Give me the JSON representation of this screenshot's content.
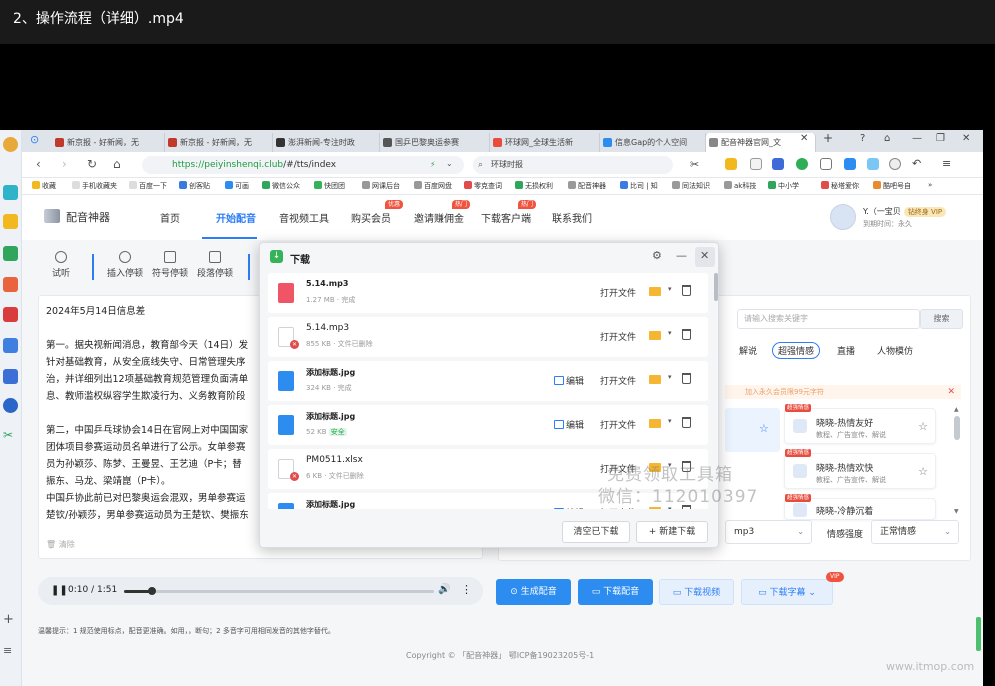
{
  "video_title": "2、操作流程（详细）.mp4",
  "browser": {
    "tabs": [
      {
        "label": "新京报 - 好新闻，无",
        "color": "#c0392b"
      },
      {
        "label": "新京报 - 好新闻，无",
        "color": "#c0392b"
      },
      {
        "label": "澎湃新闻-专注时政",
        "color": "#333333"
      },
      {
        "label": "国乒巴黎奥运参赛",
        "color": "#555555"
      },
      {
        "label": "环球网_全球生活新",
        "color": "#e74c3c"
      },
      {
        "label": "信息Gap的个人空间",
        "color": "#2d8cf0"
      },
      {
        "label": "配音神器官网_文",
        "color": "#888888"
      }
    ],
    "url_prefix": "https://",
    "url_domain": "peiyinshenqi.club",
    "url_path": "/#/tts/index",
    "search_text": "环球时报",
    "bookmarks": [
      "收藏",
      "手机收藏夹",
      "百度一下",
      "创客贴",
      "可画",
      "微信公众",
      "快团团",
      "网课后台",
      "百度网盘",
      "零克查词",
      "无损权利",
      "配音神器",
      "比司 | 知",
      "同法知识",
      "ak科技",
      "中小学",
      "秘塔爱你",
      "酷吧号自"
    ]
  },
  "app": {
    "logo": "配音神器",
    "nav": [
      {
        "label": "首页",
        "tag": ""
      },
      {
        "label": "开始配音",
        "tag": ""
      },
      {
        "label": "音视频工具",
        "tag": ""
      },
      {
        "label": "购买会员",
        "tag": "优惠"
      },
      {
        "label": "邀请赚佣金",
        "tag": "热门"
      },
      {
        "label": "下载客户端",
        "tag": "热门"
      },
      {
        "label": "联系我们",
        "tag": ""
      }
    ],
    "user_name": "Y.（一宝贝",
    "user_vip": "钻终身 VIP",
    "user_expiry": "到期时间：永久"
  },
  "tools": [
    {
      "label": "试听"
    },
    {
      "label": "插入停顿"
    },
    {
      "label": "符号停顿"
    },
    {
      "label": "段落停顿"
    }
  ],
  "editor": {
    "lines": [
      "2024年5月14日信息差",
      "",
      "第一。据央视新闻消息，教育部今天（14日）发",
      "针对基础教育，从安全底线失守、日常管理失序",
      "治，并详细列出12项基础教育规范管理负面清单",
      "息、教师滥权纵容学生欺凌行为、义务教育阶段",
      "",
      "第二，中国乒乓球协会14日在官网上对中国国家",
      "团体项目参赛运动员名单进行了公示。女单参赛",
      "员为孙颖莎、陈梦、王曼昱、王艺迪（P卡；替",
      "振东、马龙、梁靖崑（P卡）。",
      "中国乒协此前已对巴黎奥运会混双，男单参赛运",
      "楚钦/孙颖莎，男单参赛运动员为王楚钦、樊振东"
    ],
    "clear": "清除"
  },
  "player": {
    "time": "0:10 / 1:51",
    "progress": 0.09
  },
  "hint": "温馨提示：1 规范使用标点，配音更准确。如用，，断句；2 多音字可用相同发音的其他字替代。",
  "footer": "Copyright © 「配音神器」 鄂ICP备19023205号-1",
  "site_watermark": "www.itmop.com",
  "download_dialog": {
    "title": "下载",
    "items": [
      {
        "name": "5.14.mp3",
        "meta": "1.27 MB · 完成",
        "type": "mp3",
        "error": false,
        "edit": false,
        "safe": ""
      },
      {
        "name": "5.14.mp3",
        "meta": "855 KB · 文件已删除",
        "type": "doc",
        "error": true,
        "edit": false,
        "safe": ""
      },
      {
        "name": "添加标题.jpg",
        "meta": "324 KB · 完成",
        "type": "img",
        "error": false,
        "edit": true,
        "safe": ""
      },
      {
        "name": "添加标题.jpg",
        "meta": "52 KB",
        "type": "img",
        "error": false,
        "edit": true,
        "safe": "安全"
      },
      {
        "name": "PM0511.xlsx",
        "meta": "6 KB · 文件已删除",
        "type": "doc",
        "error": true,
        "edit": false,
        "safe": ""
      },
      {
        "name": "添加标题.jpg",
        "meta": "",
        "type": "img",
        "error": false,
        "edit": true,
        "safe": ""
      }
    ],
    "open_label": "打开文件",
    "edit_label": "编辑",
    "clear_label": "清空已下载",
    "new_label": "新建下载"
  },
  "promo_watermark": {
    "line1": "免费领取工具箱",
    "line2": "微信：112010397"
  },
  "voice_panel": {
    "search_placeholder": "请输入搜索关键字",
    "search_btn": "搜索",
    "tabs": [
      "解说",
      "超强情感",
      "直播",
      "人物模仿"
    ],
    "active_tab": 1,
    "notice": "加入永久会员限99元字符",
    "voices": [
      {
        "tag": "超强情感",
        "name": "晓晓-热情友好",
        "sub": "教程、广告宣传、解说"
      },
      {
        "tag": "超强情感",
        "name": "晓晓-热情欢快",
        "sub": "教程、广告宣传、解说"
      },
      {
        "tag": "超强情感",
        "name": "晓晓-冷静沉着",
        "sub": ""
      }
    ]
  },
  "settings": {
    "format": "mp3",
    "emotion_label": "情感强度",
    "emotion_value": "正常情感"
  },
  "actions": {
    "generate": "生成配音",
    "download_audio": "下载配音",
    "download_video": "下载视频",
    "download_subtitle": "下载字幕",
    "vip": "VIP"
  }
}
